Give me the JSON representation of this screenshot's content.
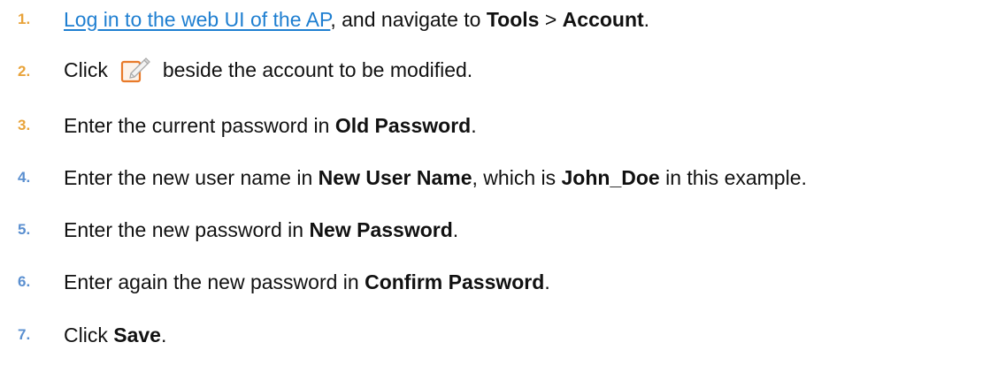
{
  "steps": [
    {
      "number": "1.",
      "link_text": "Log in to the web UI of the AP",
      "text_a": ", and navigate to ",
      "bold_a": "Tools",
      "text_b": " > ",
      "bold_b": "Account",
      "text_c": "."
    },
    {
      "number": "2.",
      "text_a": "Click",
      "icon": "edit-icon",
      "text_b": "beside the account to be modified."
    },
    {
      "number": "3.",
      "text_a": "Enter the current password in ",
      "bold_a": "Old Password",
      "text_b": "."
    },
    {
      "number": "4.",
      "text_a": "Enter the new user name in ",
      "bold_a": "New User Name",
      "text_b": ", which is ",
      "bold_b": "John_Doe",
      "text_c": " in this example."
    },
    {
      "number": "5.",
      "text_a": "Enter the new password in ",
      "bold_a": "New Password",
      "text_b": "."
    },
    {
      "number": "6.",
      "text_a": "Enter again the new password in ",
      "bold_a": "Confirm Password",
      "text_b": "."
    },
    {
      "number": "7.",
      "text_a": "Click ",
      "bold_a": "Save",
      "text_b": "."
    }
  ],
  "colors": {
    "step_number": [
      "#e8a33a",
      "#e8a33a",
      "#e8a33a",
      "#5a8fd0",
      "#5a8fd0",
      "#5a8fd0",
      "#5a8fd0"
    ],
    "link": "#1f7fd1",
    "icon_frame": "#e87a2a"
  }
}
